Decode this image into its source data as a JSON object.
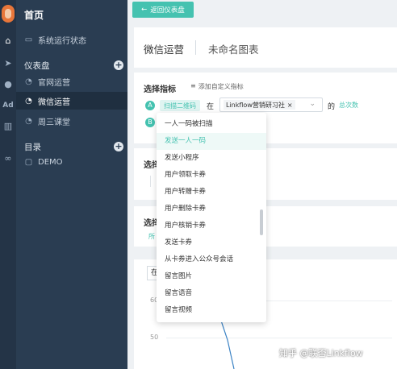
{
  "rail": {
    "icons": [
      "home-icon",
      "send-icon",
      "user-icon",
      "ad-icon",
      "bar-chart-icon",
      "link-icon"
    ],
    "ad_label": "Ad"
  },
  "sidebar": {
    "home": "首页",
    "system_status": "系统运行状态",
    "dashboard_section": "仪表盘",
    "dashboards": [
      {
        "label": "官网运营"
      },
      {
        "label": "微信运营"
      },
      {
        "label": "周三课堂"
      }
    ],
    "directory_section": "目录",
    "folders": [
      {
        "label": "DEMO"
      }
    ]
  },
  "main": {
    "back_button": "返回仪表盘",
    "tabs": {
      "active": "微信运营",
      "chart_name": "未命名图表"
    },
    "indicator": {
      "title": "选择指标",
      "add_custom": "添加自定义指标",
      "row_a_letter": "A",
      "row_b_letter": "B",
      "metric_chip": "扫描二维码",
      "in_label": "在",
      "account_tag": "Linkflow营销研习社",
      "of_label": "的",
      "total_link": "总次数"
    },
    "section3_title": "选择",
    "section4_title": "选择",
    "section4_sub": "所",
    "chart": {
      "select_value": "在",
      "y_ticks": [
        "60",
        "50"
      ]
    }
  },
  "dropdown": {
    "items": [
      "一人一码被扫描",
      "发送一人一码",
      "发送小程序",
      "用户领取卡券",
      "用户转赠卡券",
      "用户删除卡券",
      "用户核销卡券",
      "发送卡券",
      "从卡券进入公众号会话",
      "留言图片",
      "留言语音",
      "留言视频"
    ],
    "highlighted_index": 1
  },
  "watermark": "知乎 @联否Linkflow",
  "colors": {
    "accent": "#45c2b0",
    "sidebar": "#2a3d52",
    "rail": "#243447"
  }
}
